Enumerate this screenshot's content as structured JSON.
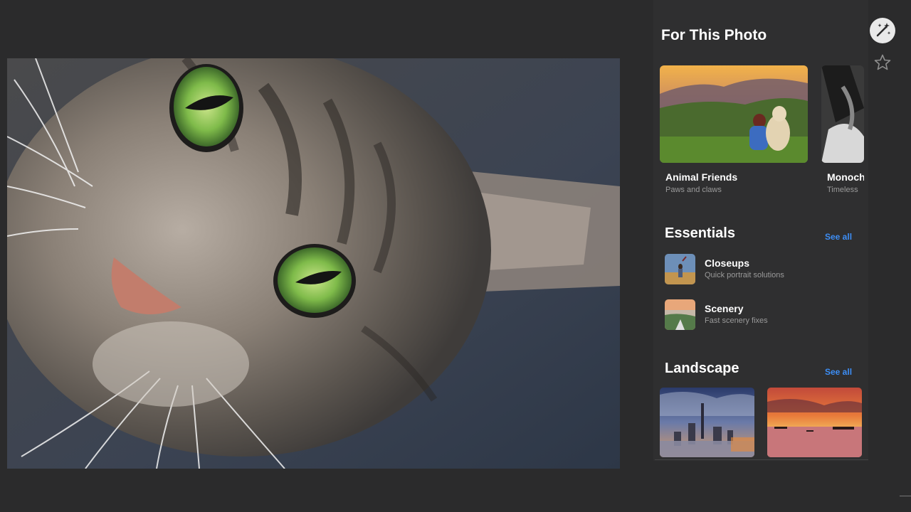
{
  "sidebar": {
    "title": "For This Photo",
    "featured": [
      {
        "title": "Animal Friends",
        "subtitle": "Paws and claws"
      },
      {
        "title": "Monoch",
        "subtitle": "Timeless"
      }
    ],
    "essentials": {
      "title": "Essentials",
      "see_all": "See all",
      "items": [
        {
          "title": "Closeups",
          "subtitle": "Quick portrait solutions"
        },
        {
          "title": "Scenery",
          "subtitle": "Fast scenery fixes"
        }
      ]
    },
    "landscape": {
      "title": "Landscape",
      "see_all": "See all"
    }
  },
  "toolbar": {
    "auto_enhance_icon": "magic-wand-icon",
    "favorite_icon": "star-icon"
  },
  "colors": {
    "background": "#2b2b2c",
    "sidebar": "#2f2f30",
    "accent": "#3d8ef5"
  }
}
